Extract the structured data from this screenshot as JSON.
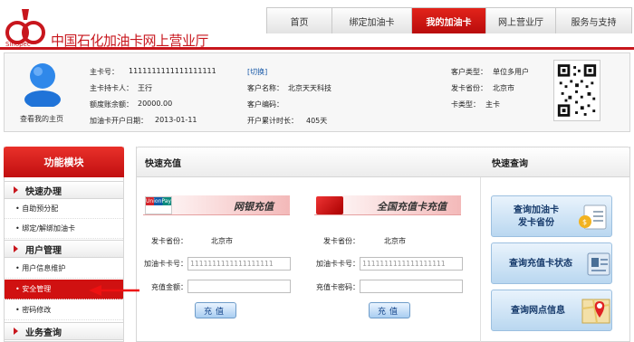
{
  "header": {
    "site_title": "中国石化加油卡网上营业厅",
    "nav": [
      "首页",
      "绑定加油卡",
      "我的加油卡",
      "网上营业厅",
      "服务与支持"
    ],
    "active_nav": "我的加油卡"
  },
  "user": {
    "home_link": "查看我的主页",
    "main_card_no_label": "主卡号：",
    "main_card_no": "1111111111111111111",
    "switch": "[切换]",
    "holder_label": "主卡持卡人：",
    "holder": "王行",
    "balance_label": "额度账余额：",
    "balance": "20000.00",
    "open_date_label": "加油卡开户日期：",
    "open_date": "2013-01-11",
    "customer_name_label": "客户名称：",
    "customer_name": "北京天天科技",
    "customer_code_label": "客户编码：",
    "customer_code": "",
    "open_days_label": "开户累计时长：",
    "open_days": "405天",
    "customer_type_label": "客户类型：",
    "customer_type": "单位多用户",
    "province_label": "发卡省份：",
    "province": "北京市",
    "card_type_label": "卡类型：",
    "card_type": "主卡"
  },
  "sidebar": {
    "title": "功能模块",
    "sections": [
      {
        "title": "快速办理",
        "items": [
          "自助预分配",
          "绑定/解绑加油卡"
        ]
      },
      {
        "title": "用户管理",
        "items": [
          "用户信息维护",
          "安全管理",
          "密码修改"
        ]
      },
      {
        "title": "业务查询",
        "items": []
      }
    ],
    "active_item": "安全管理"
  },
  "main": {
    "recharge_title": "快速充值",
    "query_title": "快速查询",
    "bank_card": {
      "logo_text": "UnionPay 银联",
      "title": "网银充值",
      "province_label": "发卡省份：",
      "province": "北京市",
      "card_no_label": "加油卡卡号：",
      "card_no_placeholder": "1111111111111111111",
      "amount_label": "充值金额：",
      "amount": "",
      "button": "充值"
    },
    "prepaid_card": {
      "title": "全国充值卡充值",
      "province_label": "发卡省份：",
      "province": "北京市",
      "card_no_label": "加油卡卡号：",
      "card_no_placeholder": "1111111111111111111",
      "password_label": "充值卡密码：",
      "password": "",
      "button": "充值"
    },
    "quick_query": [
      {
        "line1": "查询加油卡",
        "line2": "发卡省份",
        "icon": "card-list-icon"
      },
      {
        "line1": "查询充值卡状态",
        "line2": "",
        "icon": "id-card-icon"
      },
      {
        "line1": "查询网点信息",
        "line2": "",
        "icon": "map-pin-icon"
      }
    ]
  },
  "colors": {
    "brand_red": "#c8161d",
    "link_blue": "#1a5aa8"
  }
}
